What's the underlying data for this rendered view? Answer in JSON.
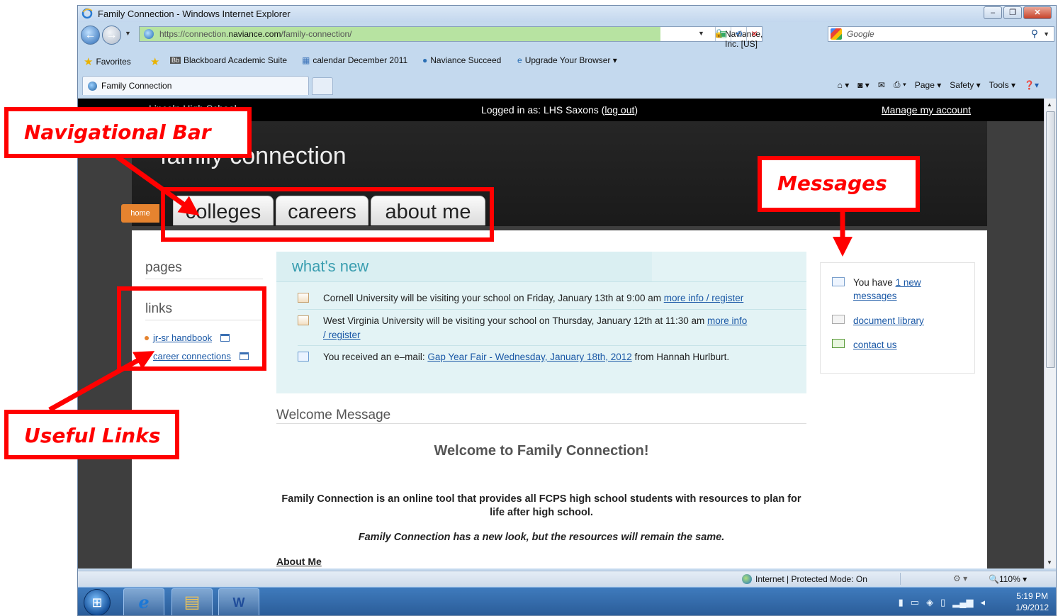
{
  "window": {
    "title": "Family Connection - Windows Internet Explorer",
    "controls": [
      "–",
      "❐",
      "✕"
    ]
  },
  "address_bar": {
    "url_prefix": "https://connection.",
    "url_host": "naviance.com",
    "url_path": "/family-connection/",
    "certificate": "Naviance, Inc. [US]",
    "search_placeholder": "Google"
  },
  "favorites_bar": {
    "favorites_label": "Favorites",
    "items": [
      "Blackboard Academic Suite",
      "calendar December 2011",
      "Naviance Succeed",
      "Upgrade Your Browser ▾"
    ]
  },
  "tab": {
    "label": "Family Connection"
  },
  "command_bar": {
    "page": "Page ▾",
    "safety": "Safety ▾",
    "tools": "Tools ▾"
  },
  "site": {
    "school_name": "Lincoln High School",
    "logged_in_prefix": "Logged in as: LHS Saxons (",
    "logout": "log out",
    "logged_in_suffix": ")",
    "manage_account": "Manage my account",
    "brand": "family connection",
    "nav": {
      "home": "home",
      "tabs": [
        "colleges",
        "careers",
        "about me"
      ]
    }
  },
  "sidebar": {
    "pages_heading": "pages",
    "links_heading": "links",
    "links": [
      "jr-sr handbook",
      "career connections"
    ]
  },
  "whats_new": {
    "title": "what's new",
    "items": [
      {
        "text": "Cornell University will be visiting your school on Friday, January 13th at 9:00 am ",
        "link": "more info / register",
        "after": ""
      },
      {
        "text": "West Virginia University will be visiting your school on Thursday, January 12th at 11:30 am ",
        "link": "more info / register",
        "after": ""
      },
      {
        "text": "You received an e–mail: ",
        "link": "Gap Year Fair - Wednesday, January 18th, 2012",
        "after": " from Hannah Hurlburt."
      }
    ]
  },
  "welcome": {
    "section_title": "Welcome Message",
    "heading": "Welcome to Family Connection!",
    "paragraph": "Family Connection is an online tool that provides all FCPS high school students with resources to plan for life after high school.",
    "italic": "Family Connection has a new look, but the resources will remain the same.",
    "about_me": "About Me"
  },
  "messages_box": {
    "you_have": "You have ",
    "new_link": "1 new messages",
    "document_library": "document library",
    "contact_us": "contact us"
  },
  "status_bar": {
    "zone": "Internet | Protected Mode: On",
    "zoom": "110%"
  },
  "taskbar": {
    "time": "5:19 PM",
    "date": "1/9/2012"
  },
  "annotations": {
    "nav_bar": "Navigational Bar",
    "messages": "Messages",
    "useful_links": "Useful Links",
    "color": "#ff0000"
  }
}
